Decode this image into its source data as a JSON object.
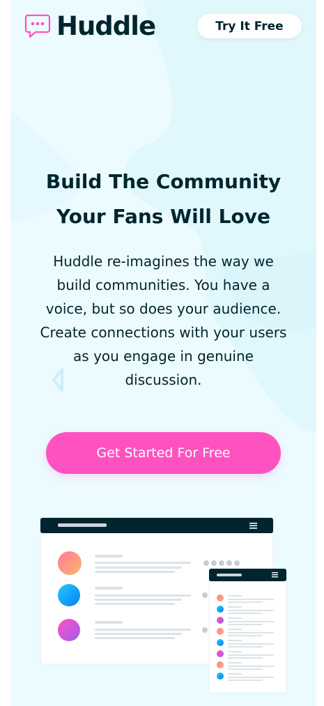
{
  "header": {
    "logo_text": "Huddle",
    "try_button": "Try It Free"
  },
  "hero": {
    "title_line1": "Build The Community",
    "title_line2": "Your Fans Will Love",
    "description": "Huddle re-imagines the way we build communities. You have a voice, but so does your audience. Create connections with your users as you engage in genuine discussion.",
    "cta": "Get Started For Free"
  },
  "colors": {
    "background": "#ecfbff",
    "text": "#00252e",
    "accent": "#ff52c1",
    "browser_bar": "#00252e"
  },
  "icons": {
    "logo": "chat-bubble-icon",
    "menu": "hamburger-menu-icon"
  }
}
